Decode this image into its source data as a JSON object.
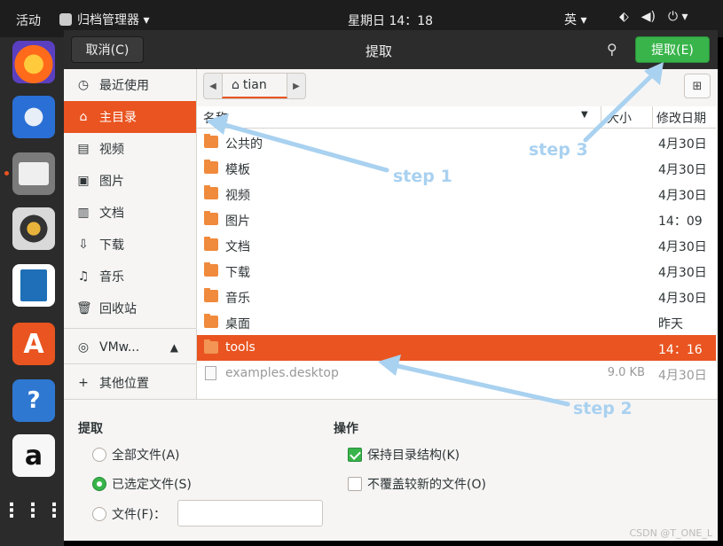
{
  "topbar": {
    "activities": "活动",
    "app_menu": "归档管理器 ▾",
    "clock": "星期日 14：18",
    "input_method": "英 ▾",
    "network_icon": "network-icon",
    "volume_icon": "volume-icon",
    "power_icon": "power-icon"
  },
  "dock": {
    "apps": [
      "firefox-icon",
      "thunderbird-icon",
      "files-icon",
      "rhythmbox-icon",
      "writer-icon",
      "software-center-icon",
      "help-icon",
      "amazon-icon",
      "app-grid-icon"
    ],
    "help_glyph": "?",
    "amazon_glyph": "a"
  },
  "header": {
    "cancel": "取消(C)",
    "title": "提取",
    "extract": "提取(E)"
  },
  "sidebar": {
    "items": [
      {
        "label": "最近使用",
        "icon": "◷"
      },
      {
        "label": "主目录",
        "icon": "⌂"
      },
      {
        "label": "视频",
        "icon": "▤"
      },
      {
        "label": "图片",
        "icon": "▣"
      },
      {
        "label": "文档",
        "icon": "▥"
      },
      {
        "label": "下载",
        "icon": "⇩"
      },
      {
        "label": "音乐",
        "icon": "♫"
      },
      {
        "label": "回收站",
        "icon": "🗑"
      }
    ],
    "device": {
      "label": "VMw...",
      "icon": "◎",
      "eject": "▲"
    },
    "other": {
      "label": "其他位置",
      "icon": "+"
    }
  },
  "pathbar": {
    "crumb": "tian",
    "home_glyph": "⌂",
    "back_glyph": "◀",
    "forward_glyph": "▶",
    "new_folder_glyph": "⊞"
  },
  "columns": {
    "name": "名称",
    "size": "大小",
    "modified": "修改日期",
    "sort_glyph": "▼"
  },
  "files": [
    {
      "name": "公共的",
      "size": "",
      "date": "4月30日",
      "type": "folder"
    },
    {
      "name": "模板",
      "size": "",
      "date": "4月30日",
      "type": "folder"
    },
    {
      "name": "视频",
      "size": "",
      "date": "4月30日",
      "type": "folder"
    },
    {
      "name": "图片",
      "size": "",
      "date": "14：09",
      "type": "folder"
    },
    {
      "name": "文档",
      "size": "",
      "date": "4月30日",
      "type": "folder"
    },
    {
      "name": "下载",
      "size": "",
      "date": "4月30日",
      "type": "folder"
    },
    {
      "name": "音乐",
      "size": "",
      "date": "4月30日",
      "type": "folder"
    },
    {
      "name": "桌面",
      "size": "",
      "date": "昨天",
      "type": "folder"
    },
    {
      "name": "tools",
      "size": "",
      "date": "14：16",
      "type": "folder",
      "selected": true
    },
    {
      "name": "examples.desktop",
      "size": "9.0 KB",
      "date": "4月30日",
      "type": "file"
    }
  ],
  "extract_section": {
    "title": "提取",
    "all_files": "全部文件(A)",
    "selected_files": "已选定文件(S)",
    "files": "文件(F)：",
    "files_input_value": ""
  },
  "actions_section": {
    "title": "操作",
    "keep_structure": "保持目录结构(K)",
    "no_overwrite": "不覆盖较新的文件(O)"
  },
  "annotations": {
    "step1": "step 1",
    "step2": "step 2",
    "step3": "step 3"
  },
  "watermark": "CSDN @T_ONE_L",
  "colors": {
    "accent": "#e95420",
    "extract_button": "#38b44a",
    "annotation": "#a9d1f0"
  }
}
